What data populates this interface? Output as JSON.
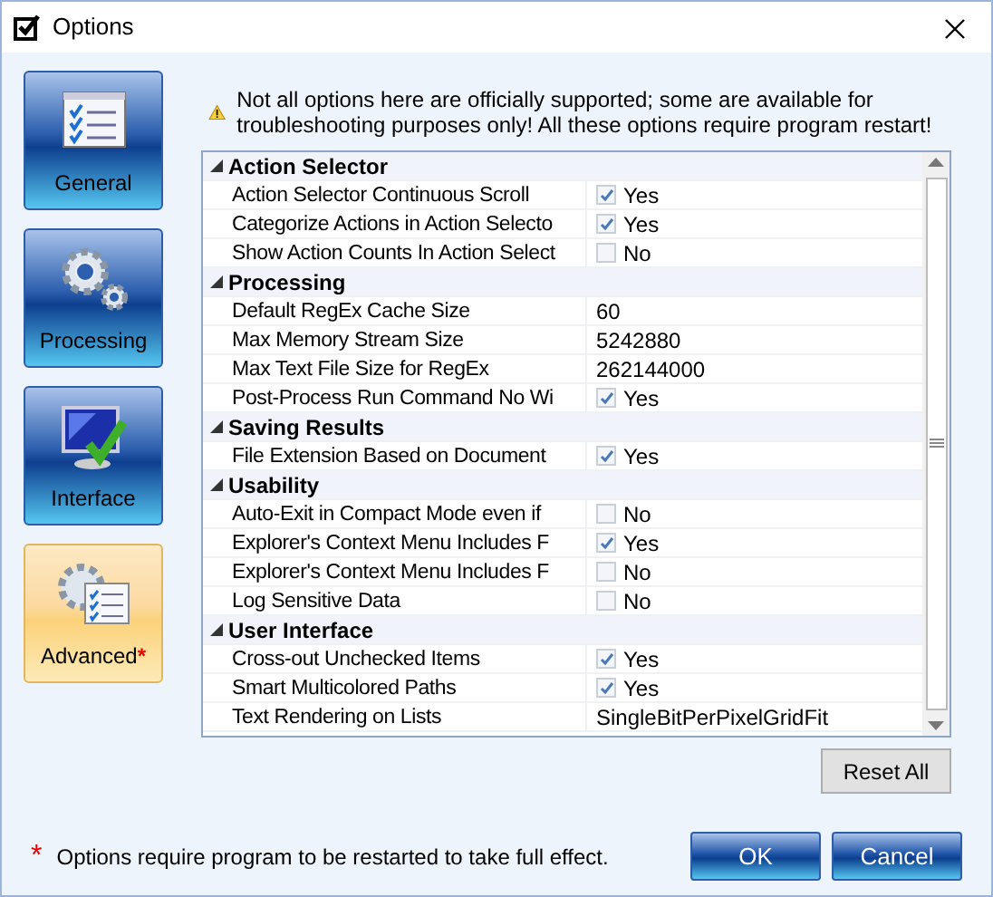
{
  "window": {
    "title": "Options"
  },
  "sidebar": {
    "items": [
      {
        "label": "General",
        "selected": false
      },
      {
        "label": "Processing",
        "selected": false
      },
      {
        "label": "Interface",
        "selected": false
      },
      {
        "label": "Advanced",
        "selected": true,
        "marker": "*"
      }
    ]
  },
  "warning": "Not all options here are officially supported; some are available for troubleshooting purposes only! All these options require program restart!",
  "grid": {
    "rows": [
      {
        "kind": "category",
        "label": "Action Selector",
        "expanded": true
      },
      {
        "kind": "checkbox",
        "label": "Action Selector Continuous Scroll",
        "checked": true,
        "value": "Yes"
      },
      {
        "kind": "checkbox",
        "label": "Categorize Actions in Action Selecto",
        "checked": true,
        "value": "Yes"
      },
      {
        "kind": "checkbox",
        "label": "Show Action Counts In Action Select",
        "checked": false,
        "value": "No"
      },
      {
        "kind": "category",
        "label": "Processing",
        "expanded": true
      },
      {
        "kind": "text",
        "label": "Default RegEx Cache Size",
        "value": "60"
      },
      {
        "kind": "text",
        "label": "Max Memory Stream Size",
        "value": "5242880"
      },
      {
        "kind": "text",
        "label": "Max Text File Size for RegEx",
        "value": "262144000"
      },
      {
        "kind": "checkbox",
        "label": "Post-Process Run Command No Wi",
        "checked": true,
        "value": "Yes"
      },
      {
        "kind": "category",
        "label": "Saving Results",
        "expanded": true
      },
      {
        "kind": "checkbox",
        "label": "File Extension Based on Document",
        "checked": true,
        "value": "Yes"
      },
      {
        "kind": "category",
        "label": "Usability",
        "expanded": true
      },
      {
        "kind": "checkbox",
        "label": "Auto-Exit in Compact Mode even if",
        "checked": false,
        "value": "No"
      },
      {
        "kind": "checkbox",
        "label": "Explorer's Context Menu Includes F",
        "checked": true,
        "value": "Yes"
      },
      {
        "kind": "checkbox",
        "label": "Explorer's Context Menu Includes F",
        "checked": false,
        "value": "No"
      },
      {
        "kind": "checkbox",
        "label": "Log Sensitive Data",
        "checked": false,
        "value": "No"
      },
      {
        "kind": "category",
        "label": "User Interface",
        "expanded": true
      },
      {
        "kind": "checkbox",
        "label": "Cross-out Unchecked Items",
        "checked": true,
        "value": "Yes"
      },
      {
        "kind": "checkbox",
        "label": "Smart Multicolored Paths",
        "checked": true,
        "value": "Yes"
      },
      {
        "kind": "text",
        "label": "Text Rendering on Lists",
        "value": "SingleBitPerPixelGridFit"
      }
    ]
  },
  "reset_button": "Reset All",
  "footnote": {
    "marker": "*",
    "text": "Options require program to be restarted to take full effect."
  },
  "buttons": [
    "OK",
    "Cancel"
  ]
}
